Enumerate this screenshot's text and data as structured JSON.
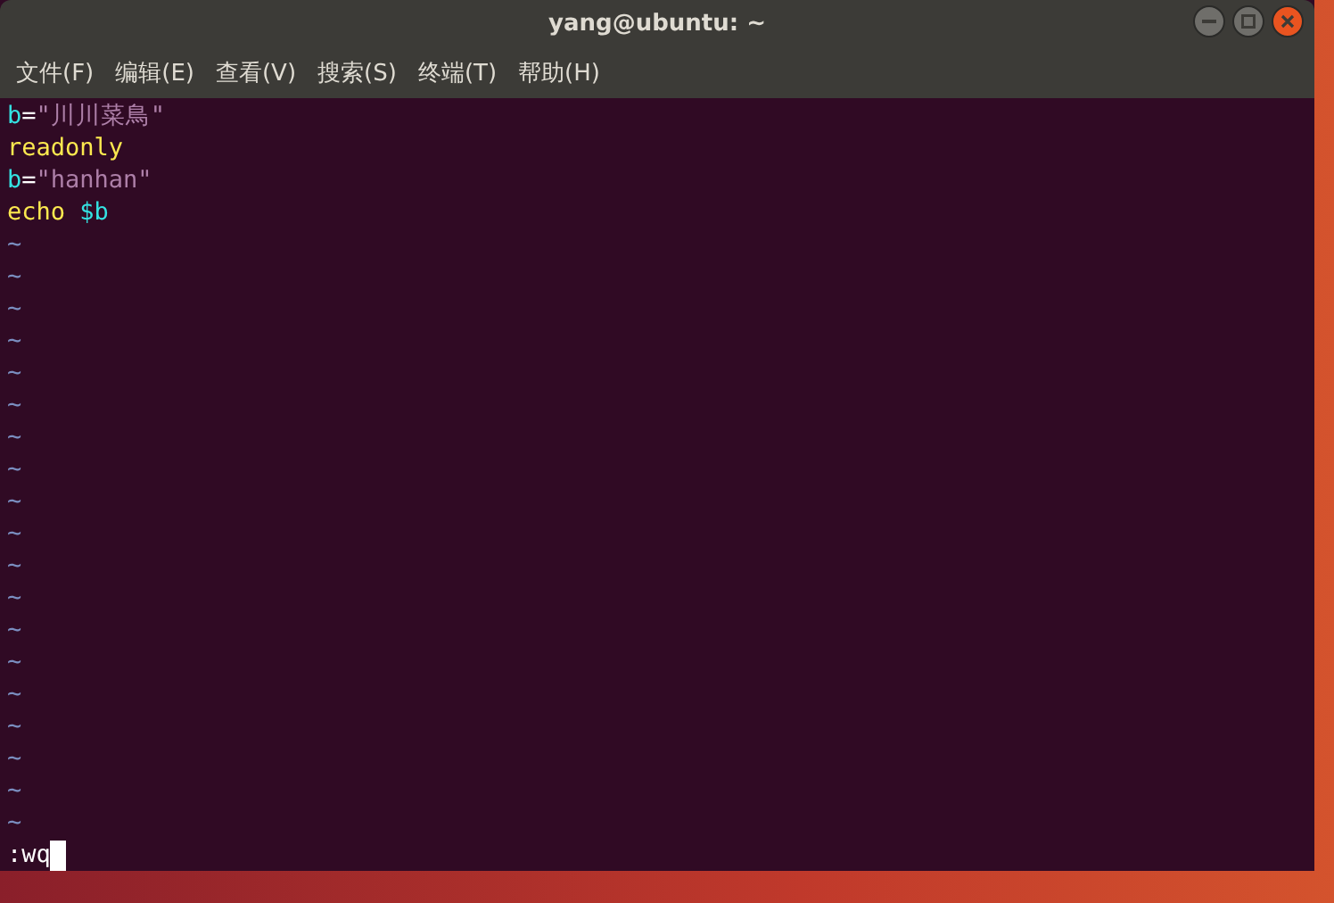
{
  "window": {
    "title": "yang@ubuntu: ~"
  },
  "menu": [
    "文件(F)",
    "编辑(E)",
    "查看(V)",
    "搜索(S)",
    "终端(T)",
    "帮助(H)"
  ],
  "lines": [
    [
      {
        "kind": "identifier",
        "text": "b"
      },
      {
        "kind": "operator",
        "text": "="
      },
      {
        "kind": "string",
        "text": "\"川川菜鳥\""
      }
    ],
    [
      {
        "kind": "keyword",
        "text": "readonly"
      }
    ],
    [
      {
        "kind": "identifier",
        "text": "b"
      },
      {
        "kind": "operator",
        "text": "="
      },
      {
        "kind": "string",
        "text": "\"hanhan\""
      }
    ],
    [
      {
        "kind": "keyword",
        "text": "echo "
      },
      {
        "kind": "identifier",
        "text": "$b"
      }
    ]
  ],
  "empty_lines": [
    "~",
    "~",
    "~",
    "~",
    "~",
    "~",
    "~",
    "~",
    "~",
    "~",
    "~",
    "~",
    "~",
    "~",
    "~",
    "~",
    "~",
    "~",
    "~"
  ],
  "command_line": ":wq"
}
